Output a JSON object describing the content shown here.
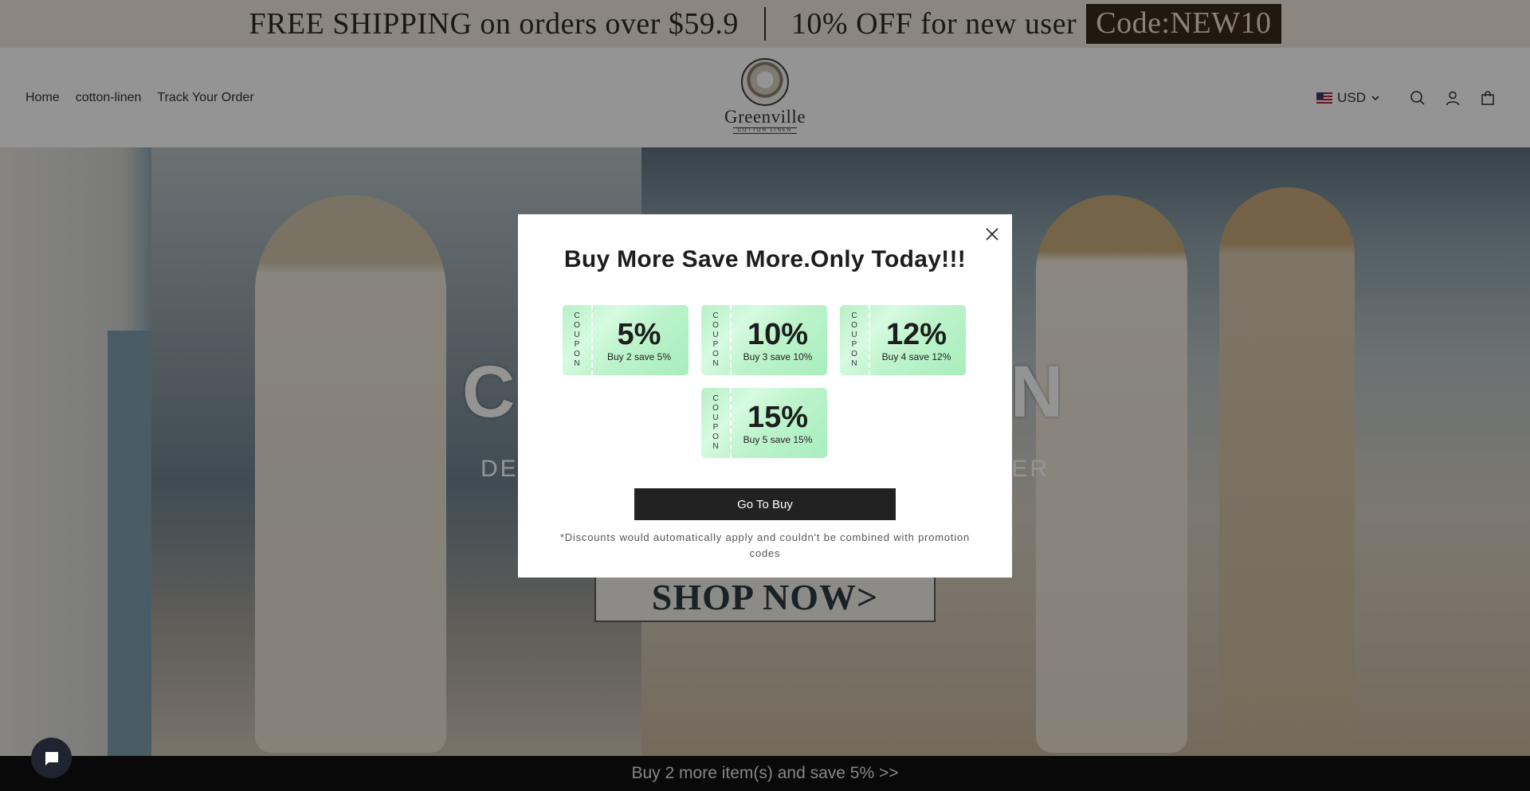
{
  "announcement": {
    "shipping_text": "FREE SHIPPING on orders over $59.9",
    "discount_text": "10% OFF for new user",
    "code_text": "Code:NEW10"
  },
  "header": {
    "nav": [
      "Home",
      "cotton-linen",
      "Track Your Order"
    ],
    "logo_name": "Greenville",
    "logo_sub": "COTTON LINEN",
    "currency": "USD",
    "icons": [
      "search-icon",
      "account-icon",
      "cart-icon"
    ]
  },
  "hero": {
    "title": "COTTON LINEN",
    "subtitle": "DESIGNED FOR SUMMER · BEACH COVER",
    "cta": "SHOP NOW>"
  },
  "modal": {
    "title": "Buy More Save More.Only Today!!!",
    "coupon_side_letters": [
      "C",
      "O",
      "U",
      "P",
      "O",
      "N"
    ],
    "coupons": [
      {
        "pct": "5%",
        "desc": "Buy 2 save 5%"
      },
      {
        "pct": "10%",
        "desc": "Buy 3 save 10%"
      },
      {
        "pct": "12%",
        "desc": "Buy 4 save 12%"
      },
      {
        "pct": "15%",
        "desc": "Buy 5 save 15%"
      }
    ],
    "button": "Go To Buy",
    "disclaimer": "*Discounts would automatically apply and couldn't be combined with promotion codes"
  },
  "bottom_bar": {
    "text": "Buy 2 more item(s) and save 5%  >>"
  },
  "colors": {
    "announcement_bg": "#efe9dc",
    "code_bg": "#3a2a1c",
    "coupon_green": "#b8f0c6",
    "button_dark": "#222222",
    "bottom_bar_bg": "#111111"
  }
}
